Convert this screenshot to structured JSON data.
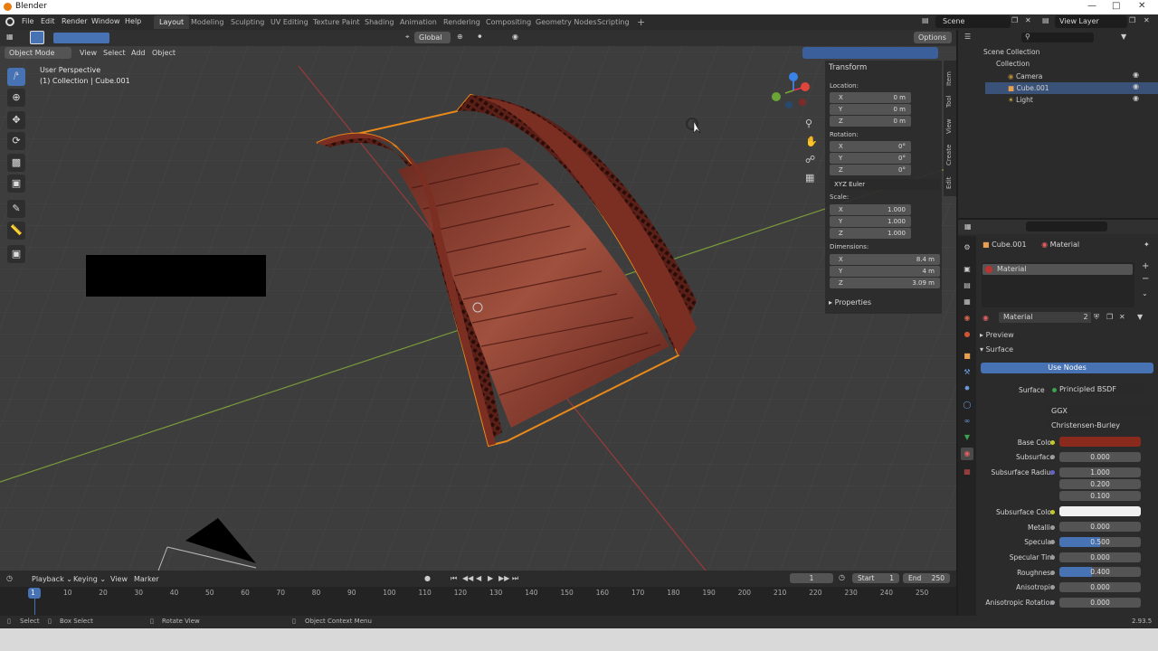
{
  "window": {
    "title": "Blender",
    "version": "2.93.5"
  },
  "menus": [
    "File",
    "Edit",
    "Render",
    "Window",
    "Help"
  ],
  "workspaces": [
    "Layout",
    "Modeling",
    "Sculpting",
    "UV Editing",
    "Texture Paint",
    "Shading",
    "Animation",
    "Rendering",
    "Compositing",
    "Geometry Nodes",
    "Scripting"
  ],
  "active_workspace": "Layout",
  "scene": {
    "name": "Scene",
    "view_layer": "View Layer"
  },
  "viewport": {
    "mode": "Object Mode",
    "menu": [
      "View",
      "Select",
      "Add",
      "Object"
    ],
    "transform_orientation": "Global",
    "options_label": "Options",
    "info_line1": "User Perspective",
    "info_line2": "(1) Collection | Cube.001"
  },
  "npanel": {
    "tabs": [
      "Item",
      "Tool",
      "View",
      "Create",
      "Edit"
    ],
    "title": "Transform",
    "location_label": "Location:",
    "location": {
      "x": "0 m",
      "y": "0 m",
      "z": "0 m"
    },
    "rotation_label": "Rotation:",
    "rotation": {
      "x": "0°",
      "y": "0°",
      "z": "0°"
    },
    "rotation_mode": "XYZ Euler",
    "scale_label": "Scale:",
    "scale": {
      "x": "1.000",
      "y": "1.000",
      "z": "1.000"
    },
    "dimensions_label": "Dimensions:",
    "dimensions": {
      "x": "8.4 m",
      "y": "4 m",
      "z": "3.09 m"
    },
    "properties_label": "Properties",
    "axis": {
      "x": "X",
      "y": "Y",
      "z": "Z"
    }
  },
  "outliner": {
    "root": "Scene Collection",
    "collection": "Collection",
    "items": [
      {
        "name": "Camera"
      },
      {
        "name": "Cube.001"
      },
      {
        "name": "Light"
      }
    ]
  },
  "properties": {
    "object": "Cube.001",
    "material_tab": "Material",
    "slot": "Material",
    "material_name": "Material",
    "users": "2",
    "preview_label": "Preview",
    "surface_label": "Surface",
    "use_nodes": "Use Nodes",
    "surface_shader_label": "Surface",
    "surface_shader": "Principled BSDF",
    "distribution": "GGX",
    "subsurface_method": "Christensen-Burley",
    "rows": [
      {
        "label": "Base Color",
        "value": ""
      },
      {
        "label": "Subsurface",
        "value": "0.000"
      },
      {
        "label": "Subsurface Radius",
        "value": "1.000"
      },
      {
        "label": "",
        "value": "0.200"
      },
      {
        "label": "",
        "value": "0.100"
      },
      {
        "label": "Subsurface Color",
        "value": ""
      },
      {
        "label": "Metallic",
        "value": "0.000"
      },
      {
        "label": "Specular",
        "value": "0.500"
      },
      {
        "label": "Specular Tint",
        "value": "0.000"
      },
      {
        "label": "Roughness",
        "value": "0.400"
      },
      {
        "label": "Anisotropic",
        "value": "0.000"
      },
      {
        "label": "Anisotropic Rotation",
        "value": "0.000"
      }
    ],
    "base_color": "#8a2a1c",
    "subsurface_color": "#f0f0f0"
  },
  "timeline": {
    "menu": [
      "Playback",
      "Keying",
      "View",
      "Marker"
    ],
    "current_frame": "1",
    "start_label": "Start",
    "start": "1",
    "end_label": "End",
    "end": "250",
    "ruler": [
      "1",
      "10",
      "20",
      "30",
      "40",
      "50",
      "60",
      "70",
      "80",
      "90",
      "100",
      "110",
      "120",
      "130",
      "140",
      "150",
      "160",
      "170",
      "180",
      "190",
      "200",
      "210",
      "220",
      "230",
      "240",
      "250"
    ]
  },
  "statusbar": {
    "select": "Select",
    "box_select": "Box Select",
    "rotate_view": "Rotate View",
    "context_menu": "Object Context Menu"
  },
  "colors": {
    "accent": "#4772b3",
    "selection_outline": "#e8891a",
    "bridge": "#7b2e22"
  }
}
